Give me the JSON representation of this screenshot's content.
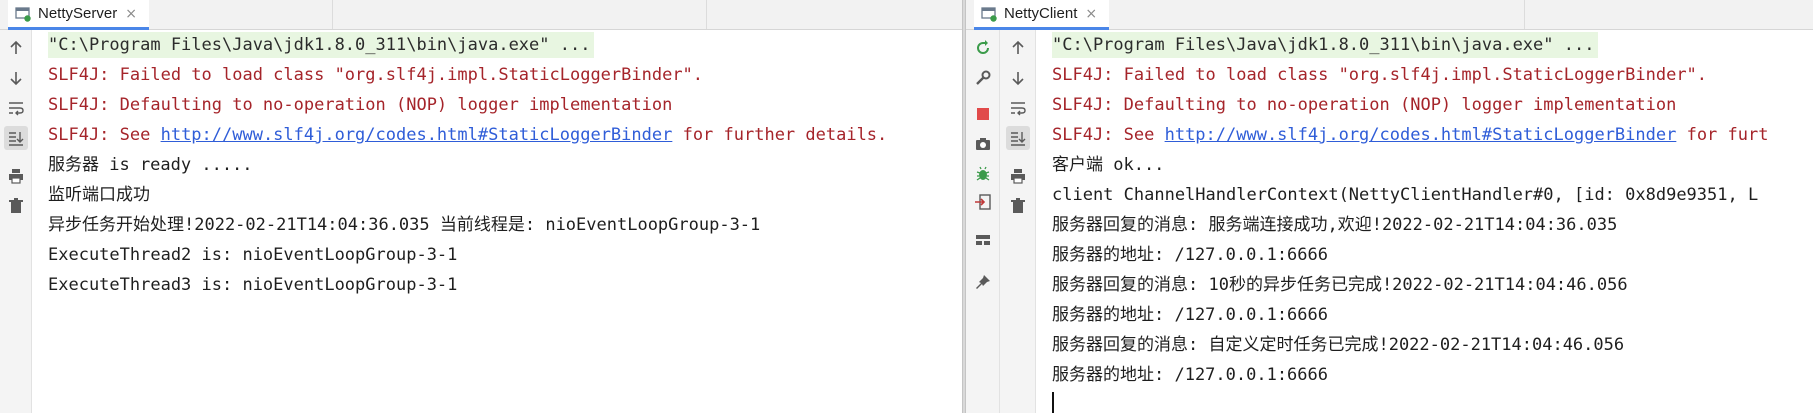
{
  "left_panel": {
    "tab": {
      "label": "NettyServer",
      "close": "×"
    },
    "gutter_icons": [
      "arrow-up-icon",
      "arrow-down-icon",
      "soft-wrap-icon",
      "scroll-to-end-icon",
      "print-icon",
      "trash-icon"
    ],
    "lines": [
      {
        "type": "cmd",
        "text": "\"C:\\Program Files\\Java\\jdk1.8.0_311\\bin\\java.exe\" ..."
      },
      {
        "type": "err",
        "text": "SLF4J: Failed to load class \"org.slf4j.impl.StaticLoggerBinder\"."
      },
      {
        "type": "err",
        "text": "SLF4J: Defaulting to no-operation (NOP) logger implementation"
      },
      {
        "type": "link",
        "prefix": "SLF4J: See ",
        "link": "http://www.slf4j.org/codes.html#StaticLoggerBinder",
        "suffix": " for further details."
      },
      {
        "type": "out",
        "text": "服务器 is ready ....."
      },
      {
        "type": "out",
        "text": "监听端口成功"
      },
      {
        "type": "out",
        "text": "异步任务开始处理!2022-02-21T14:04:36.035 当前线程是: nioEventLoopGroup-3-1"
      },
      {
        "type": "out",
        "text": "ExecuteThread2 is: nioEventLoopGroup-3-1"
      },
      {
        "type": "out",
        "text": "ExecuteThread3 is: nioEventLoopGroup-3-1"
      }
    ]
  },
  "right_panel": {
    "tab": {
      "label": "NettyClient",
      "close": "×"
    },
    "outer_gutter_icons": [
      "rerun-icon",
      "wrench-icon",
      "stop-icon",
      "camera-icon",
      "debug-bug-icon",
      "login-icon",
      "layout-icon",
      "pin-icon"
    ],
    "gutter_icons": [
      "arrow-up-icon",
      "arrow-down-icon",
      "soft-wrap-icon",
      "scroll-to-end-icon",
      "print-icon",
      "trash-icon"
    ],
    "lines": [
      {
        "type": "cmd",
        "text": "\"C:\\Program Files\\Java\\jdk1.8.0_311\\bin\\java.exe\" ..."
      },
      {
        "type": "err",
        "text": "SLF4J: Failed to load class \"org.slf4j.impl.StaticLoggerBinder\"."
      },
      {
        "type": "err",
        "text": "SLF4J: Defaulting to no-operation (NOP) logger implementation"
      },
      {
        "type": "link",
        "prefix": "SLF4J: See ",
        "link": "http://www.slf4j.org/codes.html#StaticLoggerBinder",
        "suffix": " for furt"
      },
      {
        "type": "out",
        "text": "客户端 ok..."
      },
      {
        "type": "out",
        "text": "client ChannelHandlerContext(NettyClientHandler#0, [id: 0x8d9e9351, L"
      },
      {
        "type": "out",
        "text": "服务器回复的消息: 服务端连接成功,欢迎!2022-02-21T14:04:36.035"
      },
      {
        "type": "out",
        "text": "服务器的地址: /127.0.0.1:6666"
      },
      {
        "type": "out",
        "text": "服务器回复的消息: 10秒的异步任务已完成!2022-02-21T14:04:46.056"
      },
      {
        "type": "out",
        "text": "服务器的地址: /127.0.0.1:6666"
      },
      {
        "type": "out",
        "text": "服务器回复的消息: 自定义定时任务已完成!2022-02-21T14:04:46.056"
      },
      {
        "type": "out",
        "text": "服务器的地址: /127.0.0.1:6666"
      }
    ]
  },
  "colors": {
    "cmd_bg": "#e8f6e1",
    "error_text": "#a5242a",
    "link_text": "#2f5dd8",
    "tab_underline": "#4a86e8",
    "stop_red": "#e14a4a",
    "run_green": "#3b9b4a"
  }
}
